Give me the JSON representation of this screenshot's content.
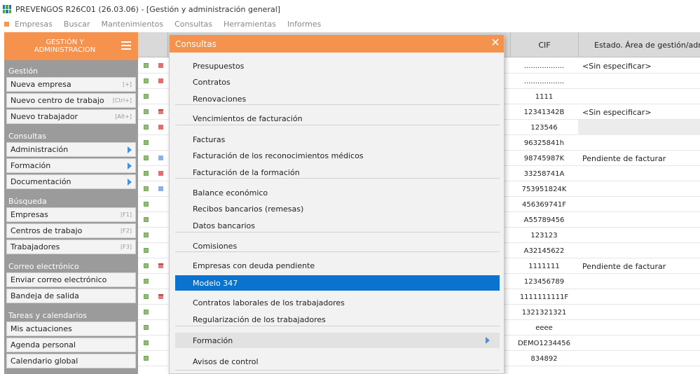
{
  "window": {
    "title": "PREVENGOS R26C01 (26.03.06) - [Gestión y administración general]"
  },
  "menubar": [
    "Empresas",
    "Buscar",
    "Mantenimientos",
    "Consultas",
    "Herramientas",
    "Informes"
  ],
  "sidebar": {
    "header_line1": "GESTIÓN Y",
    "header_line2": "ADMINISTRACION",
    "sections": [
      {
        "title": "Gestión",
        "items": [
          {
            "label": "Nueva empresa",
            "shortcut": "[+]"
          },
          {
            "label": "Nuevo centro de trabajo",
            "shortcut": "[Ctrl+]"
          },
          {
            "label": "Nuevo trabajador",
            "shortcut": "[Alt+]"
          }
        ]
      },
      {
        "title": "Consultas",
        "items": [
          {
            "label": "Administración",
            "shortcut": ""
          },
          {
            "label": "Formación",
            "shortcut": ""
          },
          {
            "label": "Documentación",
            "shortcut": ""
          }
        ]
      },
      {
        "title": "Búsqueda",
        "items": [
          {
            "label": "Empresas",
            "shortcut": "[F1]"
          },
          {
            "label": "Centros de trabajo",
            "shortcut": "[F2]"
          },
          {
            "label": "Trabajadores",
            "shortcut": "[F3]"
          }
        ]
      },
      {
        "title": "Correo electrónico",
        "items": [
          {
            "label": "Enviar correo electrónico",
            "shortcut": ""
          },
          {
            "label": "Bandeja de salida",
            "shortcut": ""
          }
        ]
      },
      {
        "title": "Tareas y calendarios",
        "items": [
          {
            "label": "Mis actuaciones",
            "shortcut": ""
          },
          {
            "label": "Agenda personal",
            "shortcut": ""
          },
          {
            "label": "Calendario global",
            "shortcut": ""
          }
        ]
      }
    ]
  },
  "grid": {
    "col_cif": "CIF",
    "col_estado": "Estado. Área de gestión/admin",
    "rows": [
      {
        "cif": "..................",
        "estado": "<Sin especificar>"
      },
      {
        "cif": "..................",
        "estado": ""
      },
      {
        "cif": "1111",
        "estado": ""
      },
      {
        "cif": "12341342B",
        "estado": "<Sin especificar>"
      },
      {
        "cif": "123546",
        "estado": ""
      },
      {
        "cif": "96325841h",
        "estado": ""
      },
      {
        "cif": "98745987K",
        "estado": "Pendiente de facturar"
      },
      {
        "cif": "33258741A",
        "estado": ""
      },
      {
        "cif": "753951824K",
        "estado": ""
      },
      {
        "cif": "456369741F",
        "estado": ""
      },
      {
        "cif": "A55789456",
        "estado": ""
      },
      {
        "cif": "123123",
        "estado": ""
      },
      {
        "cif": "A32145622",
        "estado": ""
      },
      {
        "cif": "1111111",
        "estado": "Pendiente de facturar"
      },
      {
        "cif": "123456789",
        "estado": ""
      },
      {
        "cif": "1111111111F",
        "estado": ""
      },
      {
        "cif": "1321321321",
        "estado": ""
      },
      {
        "cif": "eeee",
        "estado": ""
      },
      {
        "cif": "DEMO1234456",
        "estado": ""
      },
      {
        "cif": "834892",
        "estado": ""
      }
    ]
  },
  "popup": {
    "title": "Consultas",
    "items": [
      "Presupuestos",
      "Contratos",
      "Renovaciones",
      "Vencimientos de facturación",
      "Facturas",
      "Facturación de los reconocimientos médicos",
      "Facturación de la formación",
      "Balance económico",
      "Recibos bancarios (remesas)",
      "Datos bancarios",
      "Comisiones",
      "Empresas con deuda pendiente",
      "Modelo 347",
      "Contratos laborales de los trabajadores",
      "Regularización de los trabajadores",
      "Formación",
      "Avisos de control"
    ],
    "selected": "Modelo 347"
  },
  "colors": {
    "accent_orange": "#f4924e",
    "selection_blue": "#0a72cf",
    "sidebar_gray": "#9b9b9b"
  }
}
